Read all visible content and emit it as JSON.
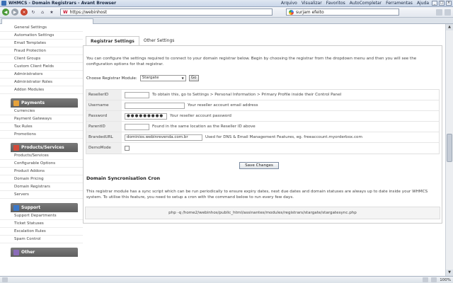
{
  "window": {
    "title": "WHMCS - Domain Registrars - Avant Browser",
    "menus": [
      "Arquivo",
      "Visualizar",
      "Favoritos",
      "AutoCompletar",
      "Ferramentas",
      "Ajuda"
    ]
  },
  "toolbar": {
    "url": "https://webinhost",
    "search": "surjam efeito"
  },
  "sidebar": {
    "config_items": [
      "General Settings",
      "Automation Settings",
      "Email Templates",
      "Fraud Protection",
      "Client Groups",
      "Custom Client Fields",
      "Administrators",
      "Administrator Roles",
      "Addon Modules"
    ],
    "payments_header": "Payments",
    "payments_items": [
      "Currencies",
      "Payment Gateways",
      "Tax Rules",
      "Promotions"
    ],
    "products_header": "Products/Services",
    "products_items": [
      "Products/Services",
      "Configurable Options",
      "Product Addons",
      "Domain Pricing",
      "Domain Registrars",
      "Servers"
    ],
    "support_header": "Support",
    "support_items": [
      "Support Departments",
      "Ticket Statuses",
      "Escalation Rules",
      "Spam Control"
    ],
    "other_header": "Other"
  },
  "main": {
    "tabs": [
      "Registrar Settings",
      "Other Settings"
    ],
    "intro": "You can configure the settings required to connect to your domain registrar below. Begin by choosing the registrar from the dropdown menu and then you will see the configuration options for that registrar.",
    "choose_label": "Choose Registrar Module:",
    "choose_value": "Stargate",
    "go_label": "Go",
    "fields": {
      "resellerid": {
        "label": "ResellerID",
        "value": "",
        "help": "To obtain this, go to Settings > Personal Information > Primary Profile inside their Control Panel"
      },
      "username": {
        "label": "Username",
        "value": "",
        "help": "Your reseller account email address"
      },
      "password": {
        "label": "Password",
        "value": "●●●●●●●●●",
        "help": "Your reseller account password"
      },
      "parentid": {
        "label": "ParentID",
        "value": "",
        "help": "Found in the same location as the Reseller ID above"
      },
      "brandedurl": {
        "label": "BrandedURL",
        "value": "dominios.webinrevenda.com.br",
        "help": "Used for DNS & Email Management Features, eg. freeaccount.myorderbox.com"
      },
      "demomode": {
        "label": "DemoMode"
      }
    },
    "save_label": "Save Changes",
    "sync_title": "Domain Syncronisation Cron",
    "sync_text": "This registrar module has a sync script which can be run periodically to ensure expiry dates, next due dates and domain statuses are always up to date inside your WHMCS system. To utilise this feature, you need to setup a cron with the command below to run every few days.",
    "cron_command": "php -q /home2/webinhos/public_html/assinantes/modules/registrars/stargate/stargatesync.php"
  },
  "status": {
    "zoom": "100%"
  }
}
